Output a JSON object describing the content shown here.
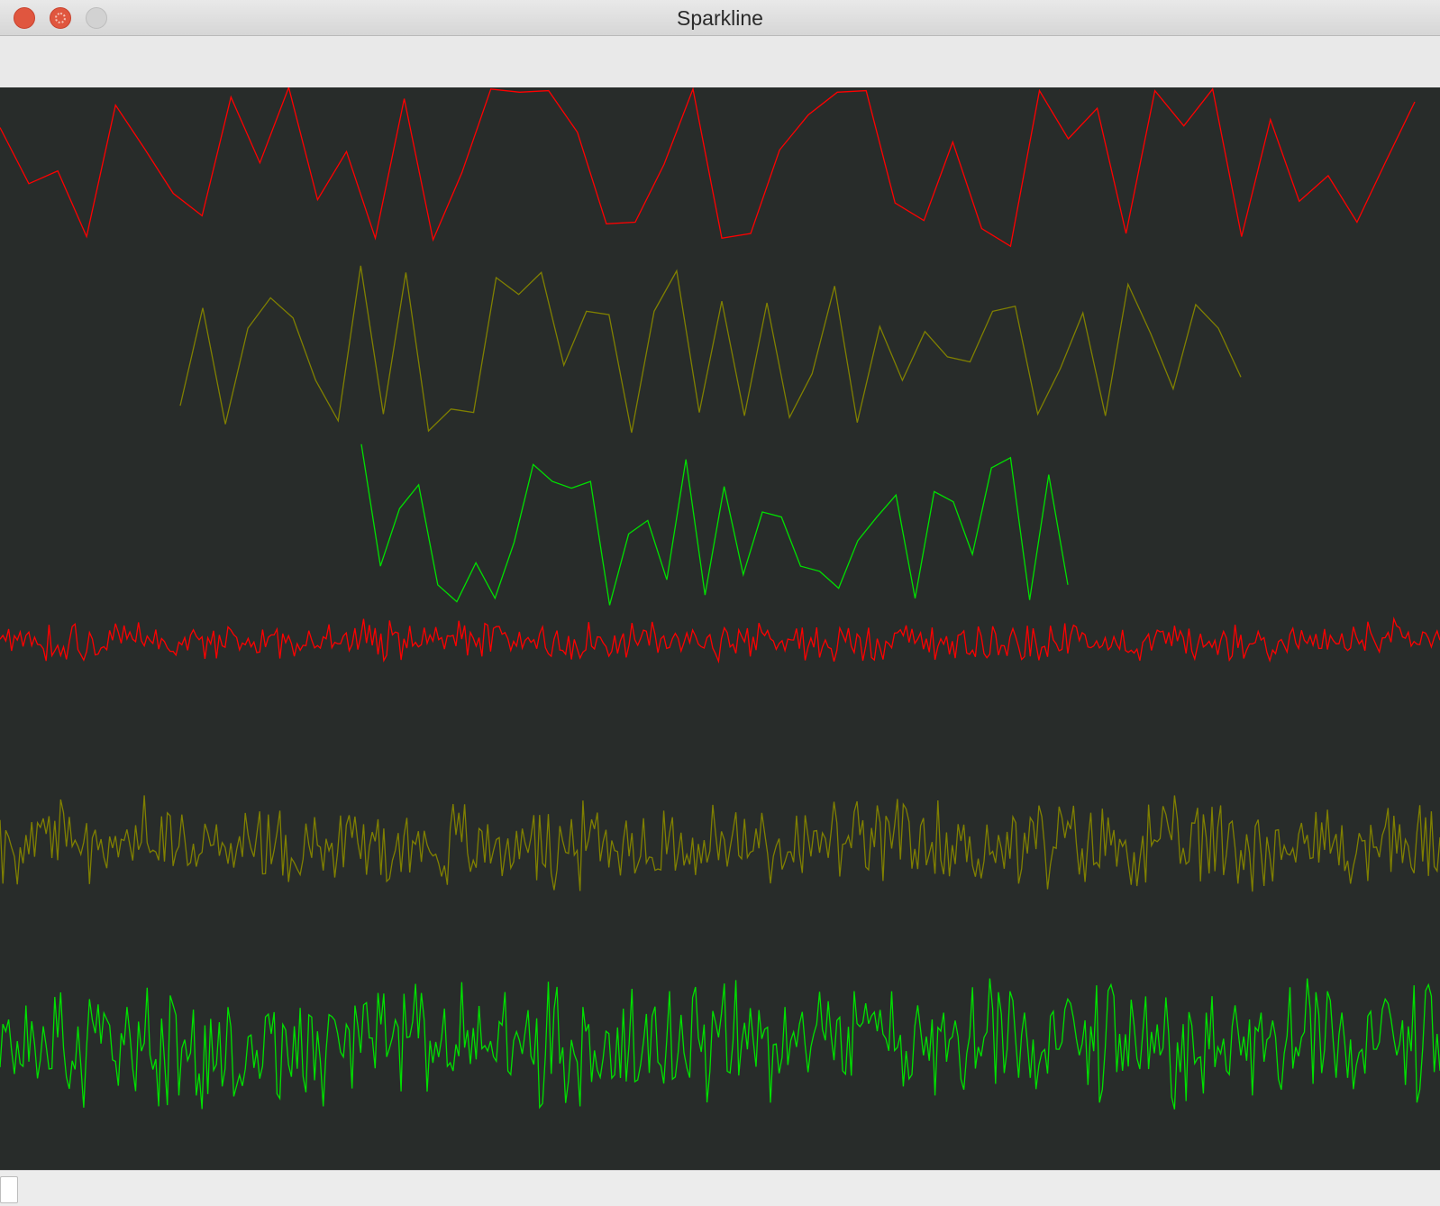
{
  "window": {
    "title": "Sparkline"
  },
  "icons": {
    "close": "close-icon",
    "minimize": "minimize-icon",
    "zoom": "zoom-icon"
  },
  "colors": {
    "background": "#282c2a",
    "red": "#ff0000",
    "olive": "#808000",
    "green": "#00e000"
  },
  "chart_data": [
    {
      "type": "line",
      "color": "#ff0000",
      "values": [
        0.75,
        0.4,
        0.48,
        0.07,
        0.89,
        0.62,
        0.34,
        0.2,
        0.94,
        0.53,
        1.0,
        0.3,
        0.6,
        0.06,
        0.93,
        0.05,
        0.47,
        0.99,
        0.97,
        0.98,
        0.72,
        0.15,
        0.16,
        0.52,
        0.99,
        0.06,
        0.09,
        0.61,
        0.83,
        0.97,
        0.98,
        0.28,
        0.17,
        0.66,
        0.12,
        0.01,
        0.98,
        0.68,
        0.87,
        0.09,
        0.98,
        0.76,
        0.99,
        0.07,
        0.8,
        0.29,
        0.45,
        0.16,
        0.54,
        0.91
      ]
    },
    {
      "type": "line",
      "color": "#808000",
      "values": [
        0.16,
        0.74,
        0.05,
        0.62,
        0.8,
        0.68,
        0.31,
        0.07,
        0.99,
        0.11,
        0.95,
        0.01,
        0.14,
        0.12,
        0.92,
        0.82,
        0.95,
        0.4,
        0.72,
        0.7,
        0.0,
        0.72,
        0.96,
        0.12,
        0.78,
        0.1,
        0.77,
        0.09,
        0.35,
        0.87,
        0.06,
        0.63,
        0.31,
        0.6,
        0.45,
        0.42,
        0.72,
        0.75,
        0.11,
        0.38,
        0.71,
        0.1,
        0.88,
        0.59,
        0.26,
        0.76,
        0.62,
        0.33
      ]
    },
    {
      "type": "line",
      "color": "#00e000",
      "values": [
        0.98,
        0.26,
        0.6,
        0.74,
        0.15,
        0.05,
        0.28,
        0.07,
        0.4,
        0.86,
        0.76,
        0.72,
        0.76,
        0.03,
        0.45,
        0.53,
        0.18,
        0.89,
        0.09,
        0.73,
        0.21,
        0.58,
        0.55,
        0.26,
        0.23,
        0.13,
        0.41,
        0.55,
        0.68,
        0.07,
        0.7,
        0.64,
        0.33,
        0.84,
        0.9,
        0.06,
        0.8,
        0.15
      ]
    },
    {
      "type": "line",
      "color": "#ff0000",
      "noise_points": 500,
      "seed": 11
    },
    {
      "type": "line",
      "color": "#808000",
      "noise_points": 500,
      "seed": 23
    },
    {
      "type": "line",
      "color": "#00e000",
      "noise_points": 500,
      "seed": 37
    }
  ]
}
